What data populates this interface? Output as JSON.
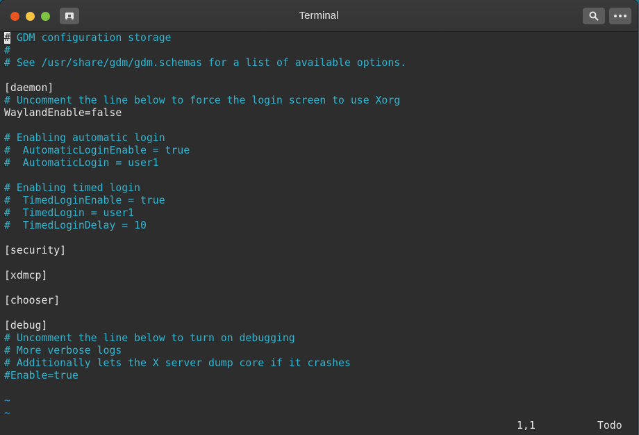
{
  "window": {
    "title": "Terminal"
  },
  "buffer": {
    "first_char": "#",
    "lines": [
      {
        "text": " GDM configuration storage",
        "kind": "comment"
      },
      {
        "text": "#",
        "kind": "comment"
      },
      {
        "text": "# See /usr/share/gdm/gdm.schemas for a list of available options.",
        "kind": "comment"
      },
      {
        "text": "",
        "kind": "plain"
      },
      {
        "text": "[daemon]",
        "kind": "plain"
      },
      {
        "text": "# Uncomment the line below to force the login screen to use Xorg",
        "kind": "comment"
      },
      {
        "text": "WaylandEnable=false",
        "kind": "plain"
      },
      {
        "text": "",
        "kind": "plain"
      },
      {
        "text": "# Enabling automatic login",
        "kind": "comment"
      },
      {
        "text": "#  AutomaticLoginEnable = true",
        "kind": "comment"
      },
      {
        "text": "#  AutomaticLogin = user1",
        "kind": "comment"
      },
      {
        "text": "",
        "kind": "plain"
      },
      {
        "text": "# Enabling timed login",
        "kind": "comment"
      },
      {
        "text": "#  TimedLoginEnable = true",
        "kind": "comment"
      },
      {
        "text": "#  TimedLogin = user1",
        "kind": "comment"
      },
      {
        "text": "#  TimedLoginDelay = 10",
        "kind": "comment"
      },
      {
        "text": "",
        "kind": "plain"
      },
      {
        "text": "[security]",
        "kind": "plain"
      },
      {
        "text": "",
        "kind": "plain"
      },
      {
        "text": "[xdmcp]",
        "kind": "plain"
      },
      {
        "text": "",
        "kind": "plain"
      },
      {
        "text": "[chooser]",
        "kind": "plain"
      },
      {
        "text": "",
        "kind": "plain"
      },
      {
        "text": "[debug]",
        "kind": "plain"
      },
      {
        "text": "# Uncomment the line below to turn on debugging",
        "kind": "comment"
      },
      {
        "text": "# More verbose logs",
        "kind": "comment"
      },
      {
        "text": "# Additionally lets the X server dump core if it crashes",
        "kind": "comment"
      },
      {
        "text": "#Enable=true",
        "kind": "comment"
      },
      {
        "text": "",
        "kind": "plain"
      },
      {
        "text": "~",
        "kind": "tilde"
      },
      {
        "text": "~",
        "kind": "tilde"
      }
    ]
  },
  "status": {
    "position": "1,1",
    "scroll": "Todo"
  },
  "colors": {
    "comment": "#2fb6d2",
    "plain": "#e4e4e4",
    "tilde": "#3a9fd8",
    "close": "#e95420",
    "minimize": "#f6c343",
    "maximize": "#7fc243"
  },
  "icons": {
    "new_tab": "new-tab-icon",
    "search": "search-icon",
    "menu": "menu-icon"
  }
}
